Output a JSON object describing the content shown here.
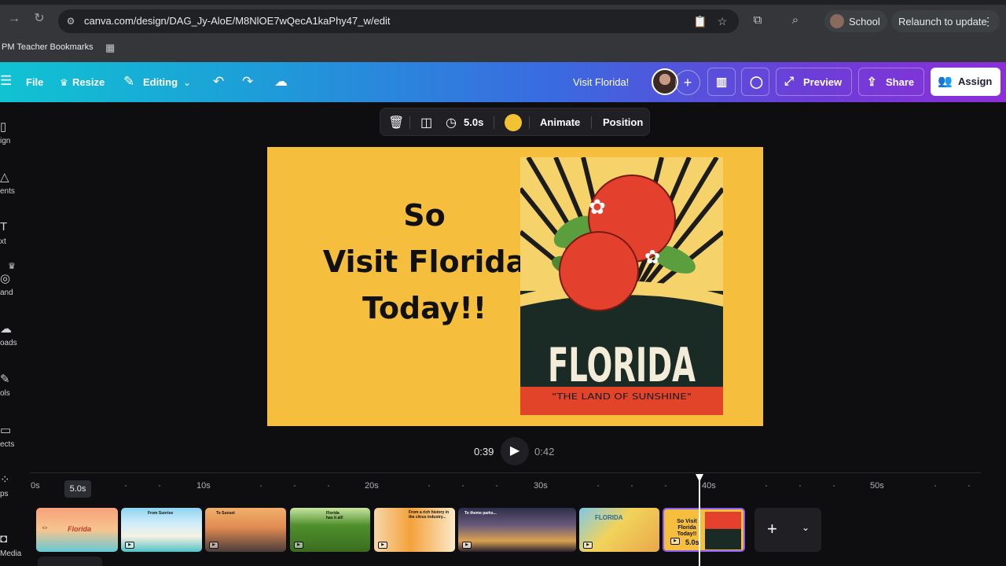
{
  "browser": {
    "url": "canva.com/design/DAG_Jy-AloE/M8NlOE7wQecA1kaPhy47_w/edit",
    "profile_label": "School",
    "relaunch_label": "Relaunch to update",
    "bookmarks_label": "PM Teacher Bookmarks"
  },
  "header": {
    "file": "File",
    "resize": "Resize",
    "editing": "Editing",
    "design_title": "Visit Florida!",
    "preview": "Preview",
    "share": "Share",
    "assign": "Assign"
  },
  "sidebar": {
    "items": [
      {
        "label": "ign"
      },
      {
        "label": "ents"
      },
      {
        "label": "xt"
      },
      {
        "label": "and"
      },
      {
        "label": "oads"
      },
      {
        "label": "ols"
      },
      {
        "label": "ects"
      },
      {
        "label": "ps"
      },
      {
        "label": "Media"
      }
    ]
  },
  "toolbar": {
    "duration": "5.0s",
    "animate": "Animate",
    "position": "Position",
    "color": "#f2c233"
  },
  "slide": {
    "line1": "So",
    "line2": "Visit Florida",
    "line3": "Today!!",
    "poster_title": "FLORIDA",
    "poster_subtitle": "\"THE LAND OF SUNSHINE\"",
    "background": "#f5bf3d"
  },
  "playback": {
    "current": "0:39",
    "total": "0:42"
  },
  "timeline": {
    "ticks": [
      "0s",
      "10s",
      "20s",
      "30s",
      "40s",
      "50s"
    ],
    "duration_badge": "5.0s",
    "thumbs": [
      {
        "caption": "Florida"
      },
      {
        "caption": "From Sunrise"
      },
      {
        "caption": "To Sunset"
      },
      {
        "caption": "Florida has it all!"
      },
      {
        "caption": "From a rich history in the citrus industry..."
      },
      {
        "caption": "To theme parks..."
      },
      {
        "caption": "FLORIDA"
      },
      {
        "caption": "So Visit Florida Today!!"
      }
    ],
    "selected_duration": "5.0s"
  }
}
